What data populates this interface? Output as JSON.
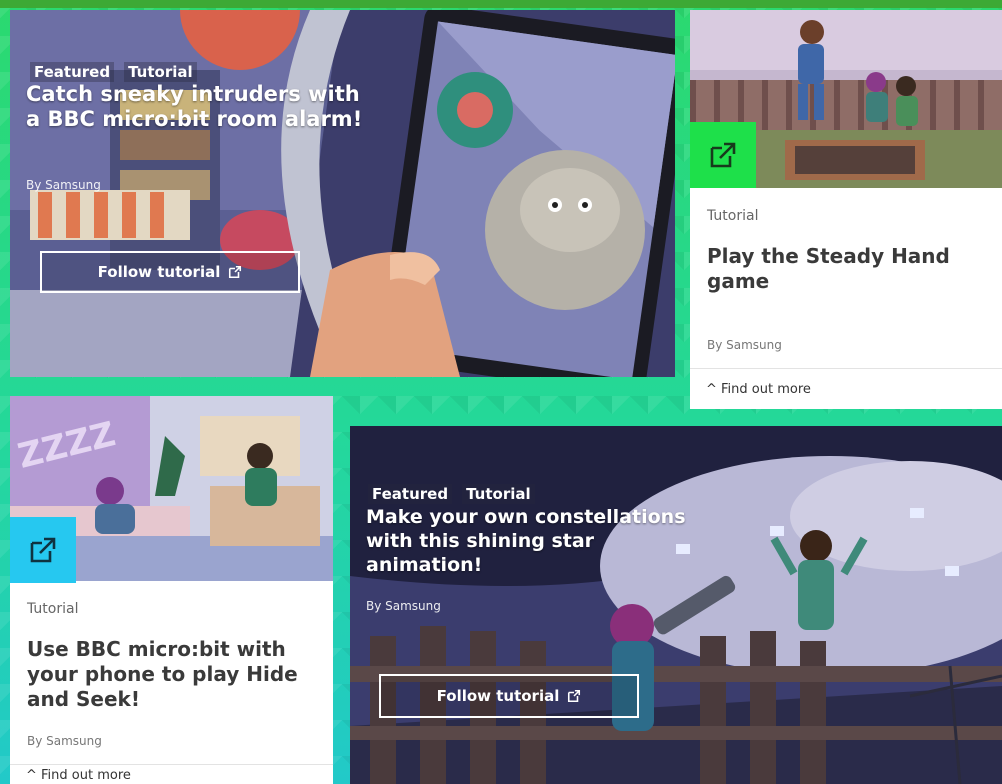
{
  "cards": {
    "alarm": {
      "tags": [
        "Featured",
        "Tutorial"
      ],
      "title": "Catch sneaky intruders with a BBC micro:bit room alarm!",
      "author": "By Samsung",
      "cta": "Follow tutorial"
    },
    "steady": {
      "kind": "Tutorial",
      "title": "Play the Steady Hand game",
      "author": "By Samsung",
      "more": "^ Find out more"
    },
    "hide": {
      "kind": "Tutorial",
      "title": "Use BBC micro:bit with your phone to play Hide and Seek!",
      "author": "By Samsung",
      "more": "^ Find out more"
    },
    "stars": {
      "tags": [
        "Featured",
        "Tutorial"
      ],
      "title": "Make your own constellations with this shining star animation!",
      "author": "By Samsung",
      "cta": "Follow tutorial"
    }
  },
  "colors": {
    "background": "#24d89a",
    "green_badge": "#1ee04a",
    "cyan_badge": "#26c8f0",
    "top_strip": "#3da935"
  },
  "icons": [
    "external-link-icon"
  ]
}
